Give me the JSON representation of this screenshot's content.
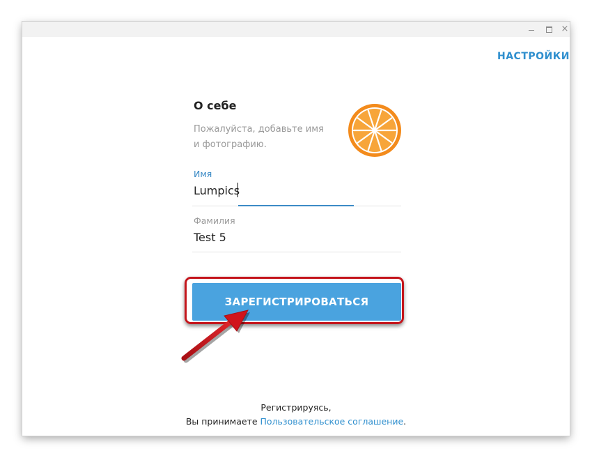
{
  "window": {
    "controls": {
      "minimize": "minimize",
      "maximize": "maximize",
      "close": "×"
    }
  },
  "header": {
    "settings_label": "НАСТРОЙКИ"
  },
  "profile": {
    "title": "О себе",
    "description_line1": "Пожалуйста, добавьте имя",
    "description_line2": "и фотографию.",
    "avatar_icon": "orange-slice-icon",
    "avatar_colors": {
      "rim": "#f38b1c",
      "pith": "#ffffff",
      "flesh": "#f7a53a"
    }
  },
  "form": {
    "first_name": {
      "label": "Имя",
      "value": "Lumpics"
    },
    "last_name": {
      "label": "Фамилия",
      "value": "Test 5"
    },
    "register_label": "ЗАРЕГИСТРИРОВАТЬСЯ"
  },
  "footer": {
    "line1": "Регистрируясь,",
    "line2_prefix": "Вы принимаете ",
    "link_text": "Пользовательское соглашение",
    "line2_suffix": "."
  },
  "annotation": {
    "highlight_color": "#c4151c",
    "arrow_color": "#d0141b"
  },
  "colors": {
    "accent": "#2f8fce",
    "button": "#4aa3df"
  }
}
